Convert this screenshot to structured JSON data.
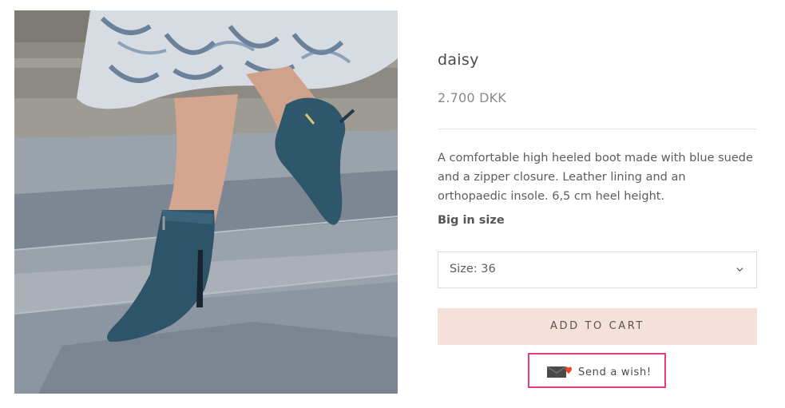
{
  "product": {
    "title": "daisy",
    "price": "2.700 DKK",
    "description": "A comfortable high heeled boot made with blue suede and a zipper closure. Leather lining and an orthopaedic insole. 6,5 cm heel height.",
    "size_note": "Big in size"
  },
  "size_selector": {
    "label": "Size:",
    "value": "36",
    "icon": "chevron-down-icon"
  },
  "actions": {
    "add_to_cart_label": "ADD TO CART",
    "send_wish_label": "Send a wish!",
    "send_wish_icon": "envelope-heart-icon"
  },
  "colors": {
    "add_to_cart_bg": "#f5e1d8",
    "highlight_border": "#e83a7c",
    "heart": "#e8452f",
    "boot": "#2d5468"
  }
}
